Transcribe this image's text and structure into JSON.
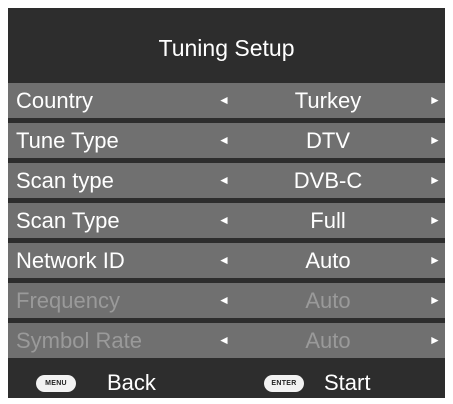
{
  "header": {
    "title": "Tuning Setup"
  },
  "arrows": {
    "left": "◄",
    "right": "►"
  },
  "rows": [
    {
      "label": "Country",
      "value": "Turkey",
      "enabled": true
    },
    {
      "label": "Tune Type",
      "value": "DTV",
      "enabled": true
    },
    {
      "label": "Scan type",
      "value": "DVB-C",
      "enabled": true
    },
    {
      "label": "Scan Type",
      "value": "Full",
      "enabled": true
    },
    {
      "label": "Network ID",
      "value": "Auto",
      "enabled": true
    },
    {
      "label": "Frequency",
      "value": "Auto",
      "enabled": false
    },
    {
      "label": "Symbol Rate",
      "value": "Auto",
      "enabled": false
    }
  ],
  "footer": {
    "menu_key": "MENU",
    "back_label": "Back",
    "enter_key": "ENTER",
    "start_label": "Start"
  },
  "colors": {
    "panel_background": "#2d2d2d",
    "row_background": "#707070",
    "text": "#ffffff",
    "disabled_text": "#9a9a9a"
  }
}
